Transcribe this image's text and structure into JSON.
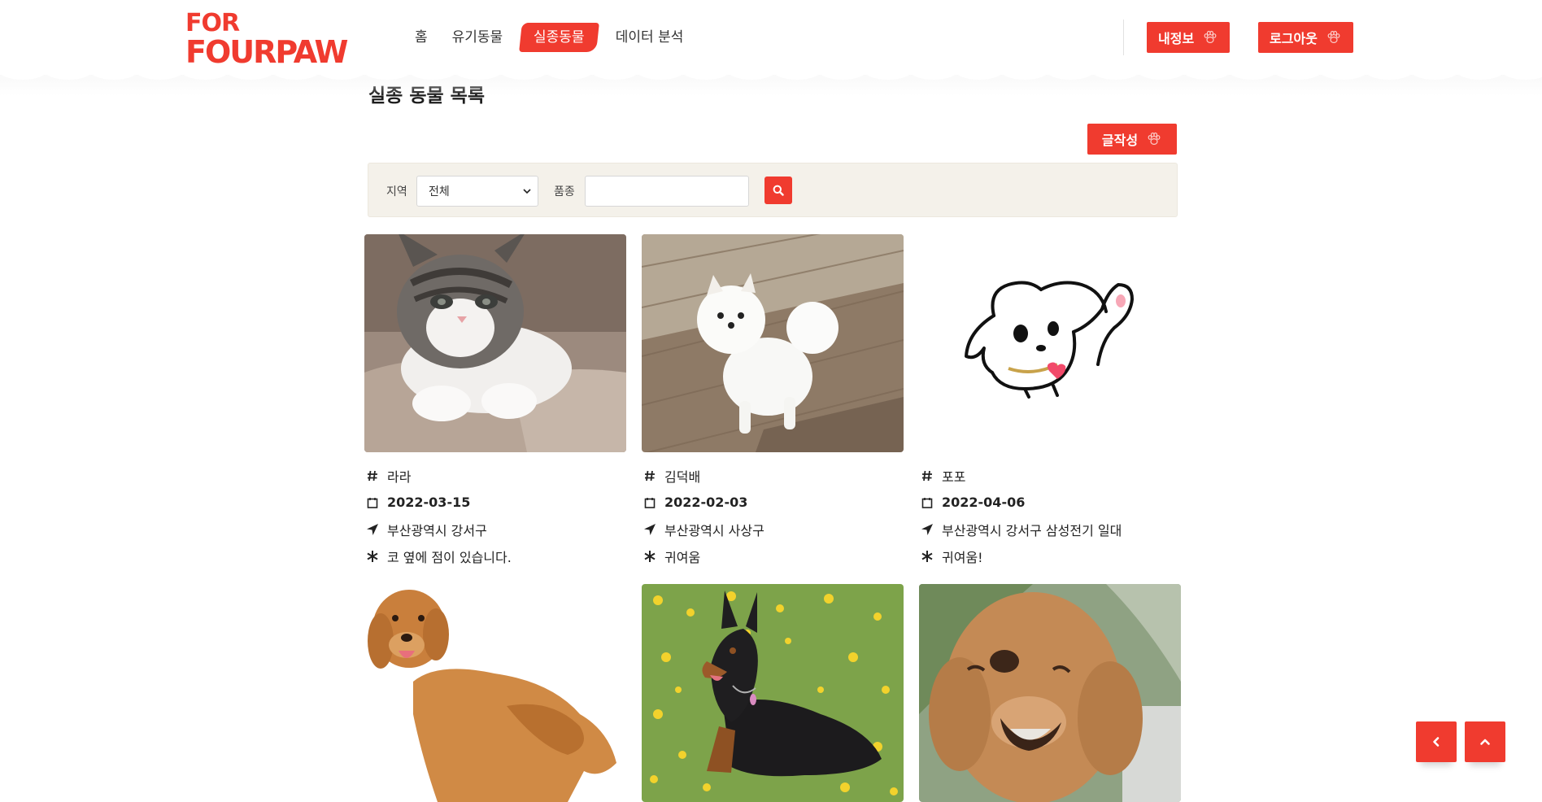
{
  "header": {
    "logo_line1": "FOR",
    "logo_line2": "FOURPAW",
    "nav": [
      {
        "label": "홈"
      },
      {
        "label": "유기동물"
      },
      {
        "label": "실종동물"
      },
      {
        "label": "데이터 분석"
      }
    ],
    "active_nav": "실종동물",
    "my_info_label": "내정보",
    "logout_label": "로그아웃"
  },
  "page": {
    "title": "실종 동물 목록",
    "write_label": "글작성"
  },
  "filter": {
    "region_label": "지역",
    "region_value": "전체",
    "breed_label": "품종",
    "breed_value": "",
    "search_icon": "search-icon"
  },
  "cards": [
    {
      "name": "라라",
      "date": "2022-03-15",
      "location": "부산광역시 강서구",
      "note": "코 옆에 점이 있습니다.",
      "image": "tabby-kitten"
    },
    {
      "name": "김덕배",
      "date": "2022-02-03",
      "location": "부산광역시 사상구",
      "note": "귀여움",
      "image": "white-pomeranian"
    },
    {
      "name": "포포",
      "date": "2022-04-06",
      "location": "부산광역시 강서구 삼성전기 일대",
      "note": "귀여움!",
      "image": "cartoon-dog-waving"
    },
    {
      "name": "",
      "date": "",
      "location": "",
      "note": "",
      "image": "golden-retriever"
    },
    {
      "name": "",
      "date": "",
      "location": "",
      "note": "",
      "image": "doberman-in-flowers"
    },
    {
      "name": "",
      "date": "",
      "location": "",
      "note": "",
      "image": "brown-poodle"
    }
  ],
  "floating": {
    "back_icon": "chevron-left-icon",
    "top_icon": "chevron-up-icon"
  },
  "colors": {
    "accent": "#f03b2f",
    "filter_bg": "#f4f1ea"
  }
}
